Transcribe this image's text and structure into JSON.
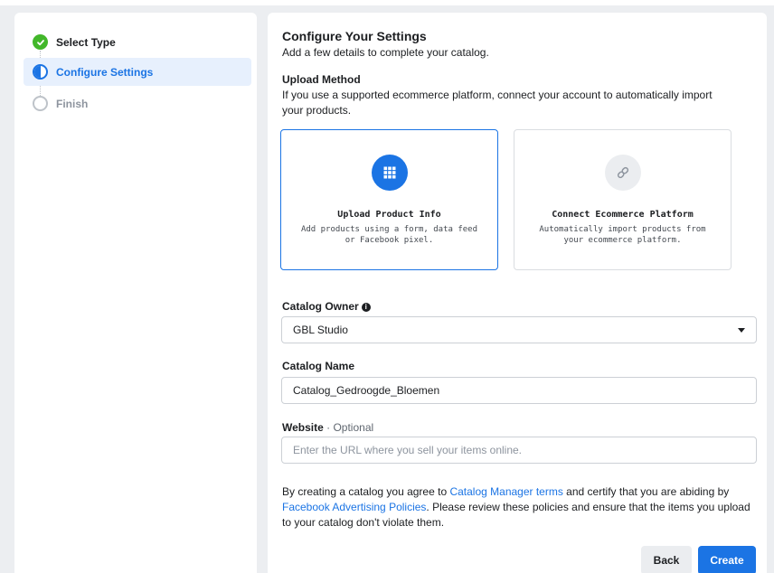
{
  "steps": [
    {
      "label": "Select Type",
      "state": "done"
    },
    {
      "label": "Configure Settings",
      "state": "current"
    },
    {
      "label": "Finish",
      "state": "pending"
    }
  ],
  "header": {
    "title": "Configure Your Settings",
    "subtitle": "Add a few details to complete your catalog."
  },
  "upload": {
    "title": "Upload Method",
    "description": "If you use a supported ecommerce platform, connect your account to automatically import your products.",
    "options": [
      {
        "title": "Upload Product Info",
        "description": "Add products using a form, data feed or Facebook pixel.",
        "icon": "grid-icon",
        "selected": true
      },
      {
        "title": "Connect Ecommerce Platform",
        "description": "Automatically import products from your ecommerce platform.",
        "icon": "link-icon",
        "selected": false
      }
    ]
  },
  "owner": {
    "label": "Catalog Owner",
    "info_icon": "i",
    "value": "GBL Studio"
  },
  "name": {
    "label": "Catalog Name",
    "value": "Catalog_Gedroogde_Bloemen"
  },
  "website": {
    "label": "Website",
    "optional": " · Optional",
    "placeholder": "Enter the URL where you sell your items online."
  },
  "legal": {
    "part1": "By creating a catalog you agree to ",
    "link1": "Catalog Manager terms",
    "part2": " and certify that you are abiding by ",
    "link2": "Facebook Advertising Policies",
    "part3": ". Please review these policies and ensure that the items you upload to your catalog don't violate them."
  },
  "buttons": {
    "back": "Back",
    "create": "Create"
  },
  "colors": {
    "accent": "#1b74e4",
    "success": "#42b72a",
    "background": "#eceef1"
  }
}
